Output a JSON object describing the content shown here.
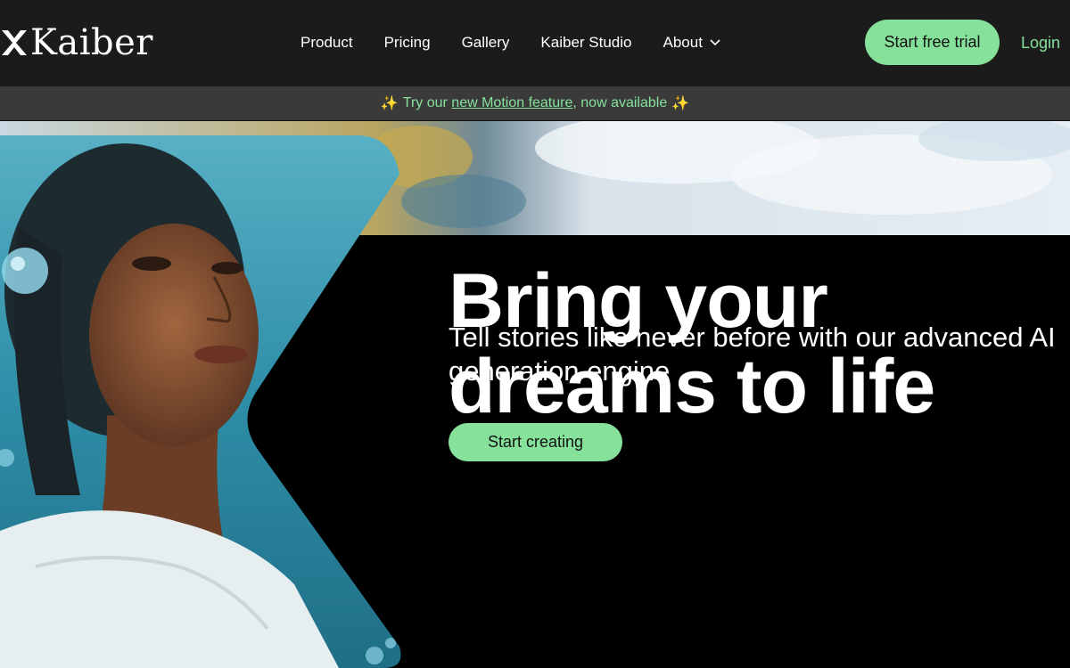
{
  "brand": {
    "logo_text": "Kaiber",
    "accent": "#86e29b"
  },
  "nav": {
    "items": [
      {
        "label": "Product"
      },
      {
        "label": "Pricing"
      },
      {
        "label": "Gallery"
      },
      {
        "label": "Kaiber Studio"
      },
      {
        "label": "About"
      }
    ],
    "trial_label": "Start free trial",
    "login_label": "Login"
  },
  "announcement": {
    "prefix": "Try our ",
    "link_text": "new Motion feature",
    "suffix": ", now available",
    "icon": "sparkles-icon"
  },
  "hero": {
    "headline_line1": "Bring your",
    "headline_line2": "dreams to life",
    "subhead": "Tell stories like never before with our advanced AI generation engine",
    "cta_label": "Start creating"
  }
}
